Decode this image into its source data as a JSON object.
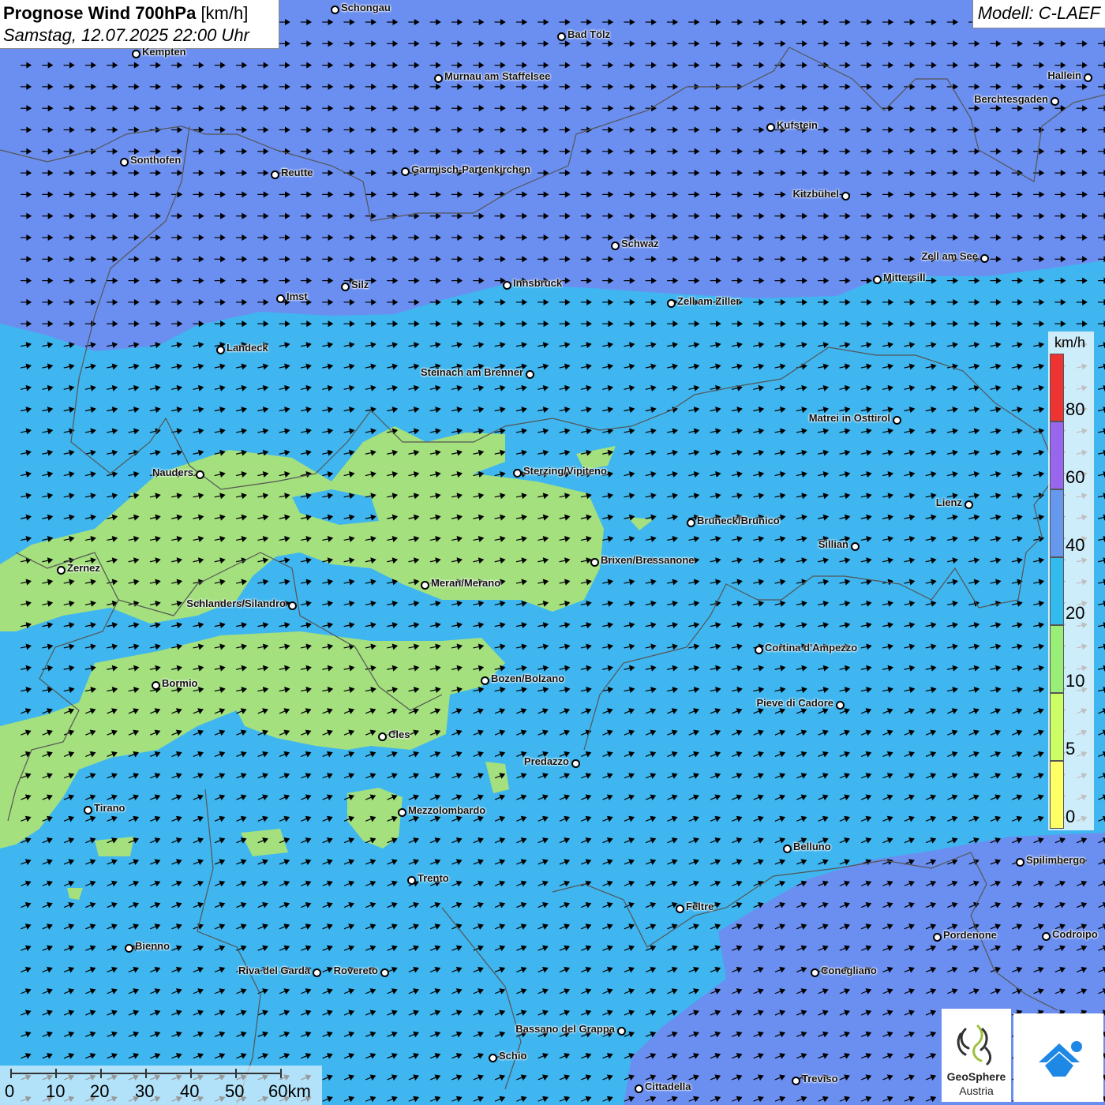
{
  "header": {
    "title_bold": "Prognose Wind 700hPa",
    "title_unit": "[km/h]",
    "datetime": "Samstag, 12.07.2025 22:00 Uhr",
    "model": "Modell: C-LAEF"
  },
  "legend": {
    "unit": "km/h",
    "bands": [
      {
        "label": "0",
        "color": "#ffff66"
      },
      {
        "label": "5",
        "color": "#ccff66"
      },
      {
        "label": "10",
        "color": "#99ee77"
      },
      {
        "label": "20",
        "color": "#33bbee"
      },
      {
        "label": "40",
        "color": "#6699ee"
      },
      {
        "label": "60",
        "color": "#9966ee"
      },
      {
        "label": "80",
        "color": "#ee3333"
      }
    ]
  },
  "scalebar": {
    "labels": [
      "0",
      "10",
      "20",
      "30",
      "40",
      "50",
      "60km"
    ]
  },
  "branding": {
    "name": "GeoSphere",
    "sub": "Austria"
  },
  "colors": {
    "zone_blue": "#6b8ff0",
    "zone_cyan": "#3fb6ef",
    "zone_green": "#a4e07e"
  },
  "cities": [
    {
      "name": "Schongau",
      "side": "r"
    },
    {
      "name": "Bad Tölz",
      "side": "r"
    },
    {
      "name": "Kempten",
      "side": "r"
    },
    {
      "name": "Murnau am Staffelsee",
      "side": "r"
    },
    {
      "name": "Hallein",
      "side": "l"
    },
    {
      "name": "Berchtesgaden",
      "side": "l"
    },
    {
      "name": "Kufstein",
      "side": "r"
    },
    {
      "name": "Sonthofen",
      "side": "r"
    },
    {
      "name": "Reutte",
      "side": "r"
    },
    {
      "name": "Garmisch-Partenkirchen",
      "side": "r"
    },
    {
      "name": "Kitzbühel",
      "side": "l"
    },
    {
      "name": "Schwaz",
      "side": "r"
    },
    {
      "name": "Zell am See",
      "side": "l"
    },
    {
      "name": "Mittersill",
      "side": "r"
    },
    {
      "name": "Innsbruck",
      "side": "r"
    },
    {
      "name": "Imst",
      "side": "r"
    },
    {
      "name": "Silz",
      "side": "r"
    },
    {
      "name": "Zell am Ziller",
      "side": "r"
    },
    {
      "name": "Landeck",
      "side": "r"
    },
    {
      "name": "Steinach am Brenner",
      "side": "l"
    },
    {
      "name": "Matrei in Osttirol",
      "side": "l"
    },
    {
      "name": "Nauders",
      "side": "l"
    },
    {
      "name": "Sterzing/Vipiteno",
      "side": "r"
    },
    {
      "name": "Lienz",
      "side": "l"
    },
    {
      "name": "Bruneck/Brunico",
      "side": "r"
    },
    {
      "name": "Sillian",
      "side": "l"
    },
    {
      "name": "Brixen/Bressanone",
      "side": "r"
    },
    {
      "name": "Zernez",
      "side": "r"
    },
    {
      "name": "Meran/Merano",
      "side": "r"
    },
    {
      "name": "Schlanders/Silandro",
      "side": "l"
    },
    {
      "name": "Cortina d'Ampezzo",
      "side": "r"
    },
    {
      "name": "Bormio",
      "side": "r"
    },
    {
      "name": "Bozen/Bolzano",
      "side": "r"
    },
    {
      "name": "Pieve di Cadore",
      "side": "l"
    },
    {
      "name": "Cles",
      "side": "r"
    },
    {
      "name": "Predazzo",
      "side": "l"
    },
    {
      "name": "Tirano",
      "side": "r"
    },
    {
      "name": "Mezzolombardo",
      "side": "r"
    },
    {
      "name": "Belluno",
      "side": "r"
    },
    {
      "name": "Spilimbergo",
      "side": "r"
    },
    {
      "name": "Trento",
      "side": "r"
    },
    {
      "name": "Feltre",
      "side": "r"
    },
    {
      "name": "Pordenone",
      "side": "r"
    },
    {
      "name": "Codroipo",
      "side": "r"
    },
    {
      "name": "Bienno",
      "side": "r"
    },
    {
      "name": "Riva del Garda",
      "side": "l"
    },
    {
      "name": "Rovereto",
      "side": "l"
    },
    {
      "name": "Conegliano",
      "side": "r"
    },
    {
      "name": "Bassano del Grappa",
      "side": "l"
    },
    {
      "name": "Schio",
      "side": "r"
    },
    {
      "name": "Treviso",
      "side": "r"
    },
    {
      "name": "Cittadella",
      "side": "r"
    }
  ]
}
